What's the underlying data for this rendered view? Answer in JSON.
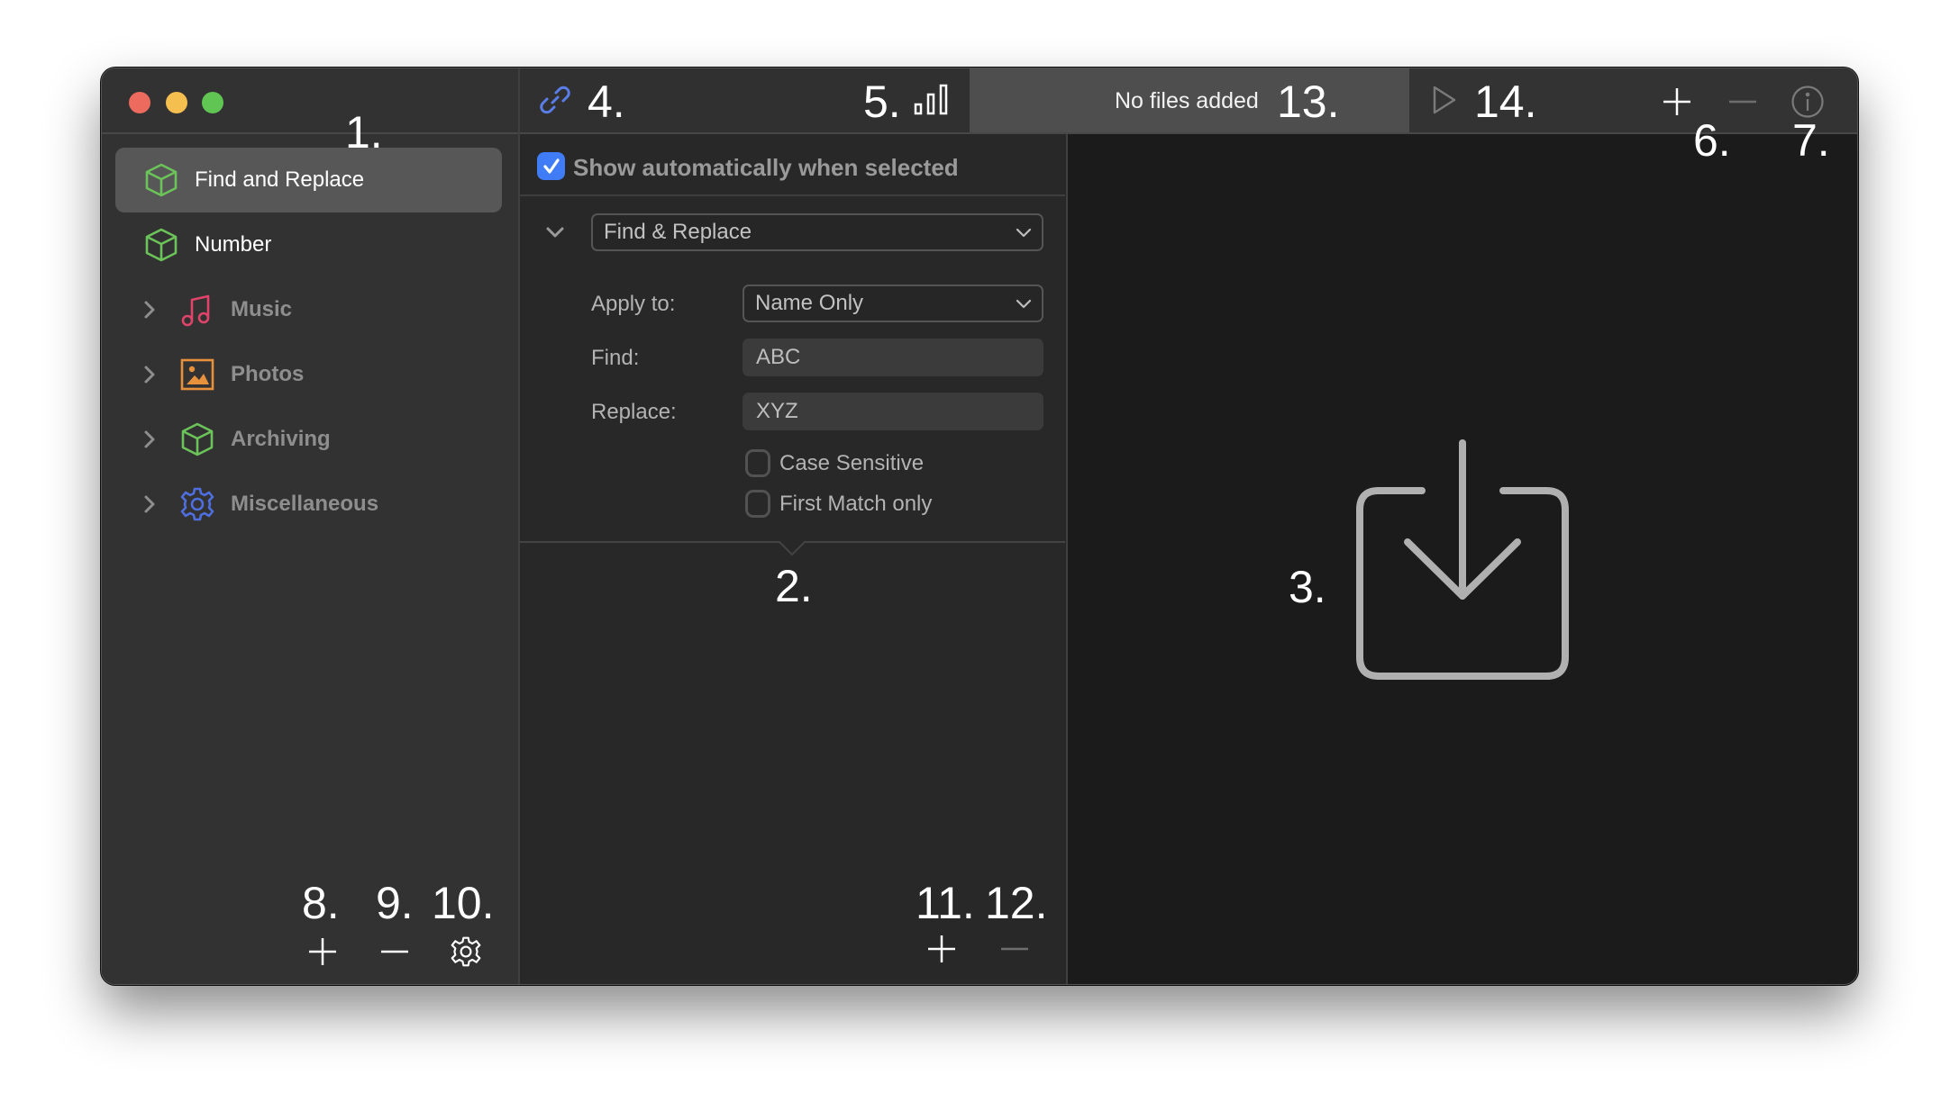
{
  "window": {
    "traffic_lights": [
      {
        "name": "close",
        "color": "#ed6a5e"
      },
      {
        "name": "minimize",
        "color": "#f5bf4f"
      },
      {
        "name": "zoom",
        "color": "#61c554"
      }
    ]
  },
  "toolbar": {
    "link_icon": "link-icon",
    "stats_icon": "bar-chart-icon",
    "status_text": "No files added",
    "run_icon": "play-icon",
    "add_icon": "plus-icon",
    "remove_icon": "minus-icon",
    "info_icon": "info-icon"
  },
  "callouts": {
    "c1": "1.",
    "c2": "2.",
    "c3": "3.",
    "c4": "4.",
    "c5": "5.",
    "c6": "6.",
    "c7": "7.",
    "c8": "8.",
    "c9": "9.",
    "c10": "10.",
    "c11": "11.",
    "c12": "12.",
    "c13": "13.",
    "c14": "14."
  },
  "sidebar": {
    "items": [
      {
        "label": "Find and Replace",
        "icon": "cube-icon",
        "icon_color": "#6cc35a",
        "selected": true,
        "expandable": false
      },
      {
        "label": "Number",
        "icon": "cube-icon",
        "icon_color": "#6cc35a",
        "selected": false,
        "expandable": false
      },
      {
        "label": "Music",
        "icon": "music-note-icon",
        "icon_color": "#e0446b",
        "selected": false,
        "expandable": true
      },
      {
        "label": "Photos",
        "icon": "photo-icon",
        "icon_color": "#e8913c",
        "selected": false,
        "expandable": true
      },
      {
        "label": "Archiving",
        "icon": "cube-icon",
        "icon_color": "#6cc35a",
        "selected": false,
        "expandable": true
      },
      {
        "label": "Miscellaneous",
        "icon": "gear-icon",
        "icon_color": "#4f6fe0",
        "selected": false,
        "expandable": true
      }
    ],
    "footer": {
      "add_icon": "plus-icon",
      "remove_icon": "minus-icon",
      "settings_icon": "gear-icon"
    }
  },
  "editor": {
    "show_auto_label": "Show automatically when selected",
    "show_auto_checked": true,
    "action_select": "Find & Replace",
    "apply_to_label": "Apply to:",
    "apply_to_value": "Name Only",
    "find_label": "Find:",
    "find_value": "ABC",
    "replace_label": "Replace:",
    "replace_value": "XYZ",
    "case_sensitive_label": "Case Sensitive",
    "case_sensitive_checked": false,
    "first_match_label": "First Match only",
    "first_match_checked": false,
    "footer": {
      "add_icon": "plus-icon",
      "remove_icon": "minus-icon"
    }
  },
  "dropzone": {
    "icon": "import-tray-icon"
  },
  "colors": {
    "accent": "#3f7cf5"
  }
}
